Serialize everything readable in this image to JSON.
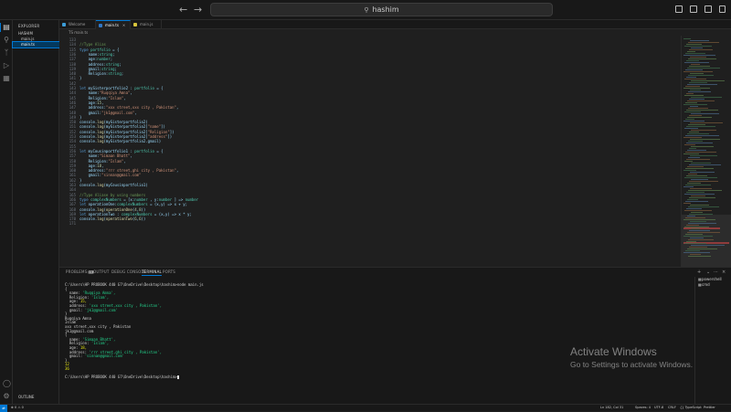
{
  "titlebar": {
    "search_text": "hashim",
    "back_icon": "arrow-left-icon",
    "forward_icon": "arrow-right-icon"
  },
  "activity_bar": {
    "icons": [
      "files-icon",
      "search-icon",
      "source-control-icon",
      "run-debug-icon",
      "extensions-icon",
      "account-icon",
      "settings-gear-icon"
    ]
  },
  "sidebar": {
    "title": "EXPLORER",
    "items": [
      {
        "label": "HASHIM",
        "selected": false
      },
      {
        "label": "main.js",
        "selected": false
      },
      {
        "label": "main.ts",
        "selected": true
      }
    ],
    "outline_label": "OUTLINE"
  },
  "tabs": [
    {
      "label": "Welcome",
      "active": false
    },
    {
      "label": "main.ts",
      "active": true
    },
    {
      "label": "main.js",
      "active": false
    }
  ],
  "breadcrumb": "TS main.ts",
  "editor": {
    "lines": [
      {
        "n": "133",
        "t": ""
      },
      {
        "n": "134",
        "t": "//Type Alias"
      },
      {
        "n": "135",
        "t": "type portfolio = {"
      },
      {
        "n": "136",
        "t": "    name:string;"
      },
      {
        "n": "137",
        "t": "    age:number;"
      },
      {
        "n": "138",
        "t": "    address:string;"
      },
      {
        "n": "139",
        "t": "    gmail:string;"
      },
      {
        "n": "140",
        "t": "    Religion:string;"
      },
      {
        "n": "141",
        "t": "}"
      },
      {
        "n": "142",
        "t": ""
      },
      {
        "n": "143",
        "t": "let mySisterportfolio2 : portfolio = {"
      },
      {
        "n": "144",
        "t": "    name:\"Ruqqiya Amna\","
      },
      {
        "n": "145",
        "t": "    Religion:\"Islam\","
      },
      {
        "n": "146",
        "t": "    age:15,"
      },
      {
        "n": "147",
        "t": "    address:\"xxx street,xxx city , Pakistan\","
      },
      {
        "n": "148",
        "t": "    gmail:\"jk1@gmail.com\","
      },
      {
        "n": "149",
        "t": "}"
      },
      {
        "n": "150",
        "t": "console.log(mySisterportfolio2)"
      },
      {
        "n": "151",
        "t": "console.log(mySisterportfolio2[\"name\"])"
      },
      {
        "n": "152",
        "t": "console.log(mySisterportfolio2[\"Religion\"])"
      },
      {
        "n": "153",
        "t": "console.log(mySisterportfolio2[\"address\"])"
      },
      {
        "n": "154",
        "t": "console.log(mySisterportfolio2.gmail)"
      },
      {
        "n": "155",
        "t": ""
      },
      {
        "n": "156",
        "t": "let myCousinportfolio1 : portfolio = {"
      },
      {
        "n": "157",
        "t": "    name:\"Simaan Bhatt\","
      },
      {
        "n": "158",
        "t": "    Religion:\"Islam\","
      },
      {
        "n": "159",
        "t": "    age:18,"
      },
      {
        "n": "160",
        "t": "    address:\"rrr street,ghi city , Pakistan\","
      },
      {
        "n": "161",
        "t": "    gmail:\"sinnan@gmail.com\""
      },
      {
        "n": "162",
        "t": "}"
      },
      {
        "n": "163",
        "t": "console.log(myCousinportfolio1)"
      },
      {
        "n": "164",
        "t": ""
      },
      {
        "n": "165",
        "t": "//Type Aliase by using numbers"
      },
      {
        "n": "166",
        "t": "type complexNumbers = [x:number , y:number ] => number"
      },
      {
        "n": "167",
        "t": "let operationOne:complexNumbers = (x,y) => x + y;"
      },
      {
        "n": "168",
        "t": "console.log(operationOne(4,8))"
      },
      {
        "n": "169",
        "t": "let operationTwo : complexNumbers = (x,y) => x * y;"
      },
      {
        "n": "170",
        "t": "console.log(operationTwo(6,6))"
      },
      {
        "n": "171",
        "t": ""
      }
    ]
  },
  "panel": {
    "tabs": [
      {
        "label": "PROBLEMS",
        "badge": "13",
        "active": false
      },
      {
        "label": "OUTPUT",
        "active": false
      },
      {
        "label": "DEBUG CONSOLE",
        "active": false
      },
      {
        "label": "TERMINAL",
        "active": true
      },
      {
        "label": "PORTS",
        "active": false
      }
    ],
    "terminal_lines": [
      {
        "t": "C:\\Users\\HP PROBOOK 440 G7\\OneDrive\\Desktop\\hashim>node main.js",
        "c": "key"
      },
      {
        "t": "{",
        "c": "key"
      },
      {
        "t": "  name: 'Ruqqiya Amna',",
        "c": "str"
      },
      {
        "t": "  Religion: 'Islam',",
        "c": "str"
      },
      {
        "t": "  age: 15,",
        "c": "num"
      },
      {
        "t": "  address: 'xxx street,xxx city , Pakistan',",
        "c": "str"
      },
      {
        "t": "  gmail: 'jk1@gmail.com'",
        "c": "str"
      },
      {
        "t": "}",
        "c": "key"
      },
      {
        "t": "Ruqqiya Amna",
        "c": "key"
      },
      {
        "t": "Islam",
        "c": "key"
      },
      {
        "t": "xxx street,xxx city , Pakistan",
        "c": "key"
      },
      {
        "t": "jk1@gmail.com",
        "c": "key"
      },
      {
        "t": "{",
        "c": "key"
      },
      {
        "t": "  name: 'Simaan Bhatt',",
        "c": "str"
      },
      {
        "t": "  Religion: 'Islam',",
        "c": "str"
      },
      {
        "t": "  age: 18,",
        "c": "num"
      },
      {
        "t": "  address: 'rrr street,ghi city , Pakistan',",
        "c": "str"
      },
      {
        "t": "  gmail: 'sinnan@gmail.com'",
        "c": "str"
      },
      {
        "t": "}",
        "c": "key"
      },
      {
        "t": "12",
        "c": "num"
      },
      {
        "t": "36",
        "c": "num"
      },
      {
        "t": "",
        "c": "key"
      },
      {
        "t": "C:\\Users\\HP PROBOOK 440 G7\\OneDrive\\Desktop\\hashim>",
        "c": "key"
      }
    ],
    "terminal_list": [
      {
        "label": "powershell"
      },
      {
        "label": "cmd"
      }
    ]
  },
  "statusbar": {
    "left": [
      "⊗ 0  ⚠ 0"
    ],
    "right": [
      "Ln 182, Col 31",
      "Spaces: 4",
      "UTF-8",
      "CRLF",
      "{} TypeScript",
      "Prettier"
    ]
  },
  "watermark": {
    "title": "Activate Windows",
    "subtitle": "Go to Settings to activate Windows."
  }
}
